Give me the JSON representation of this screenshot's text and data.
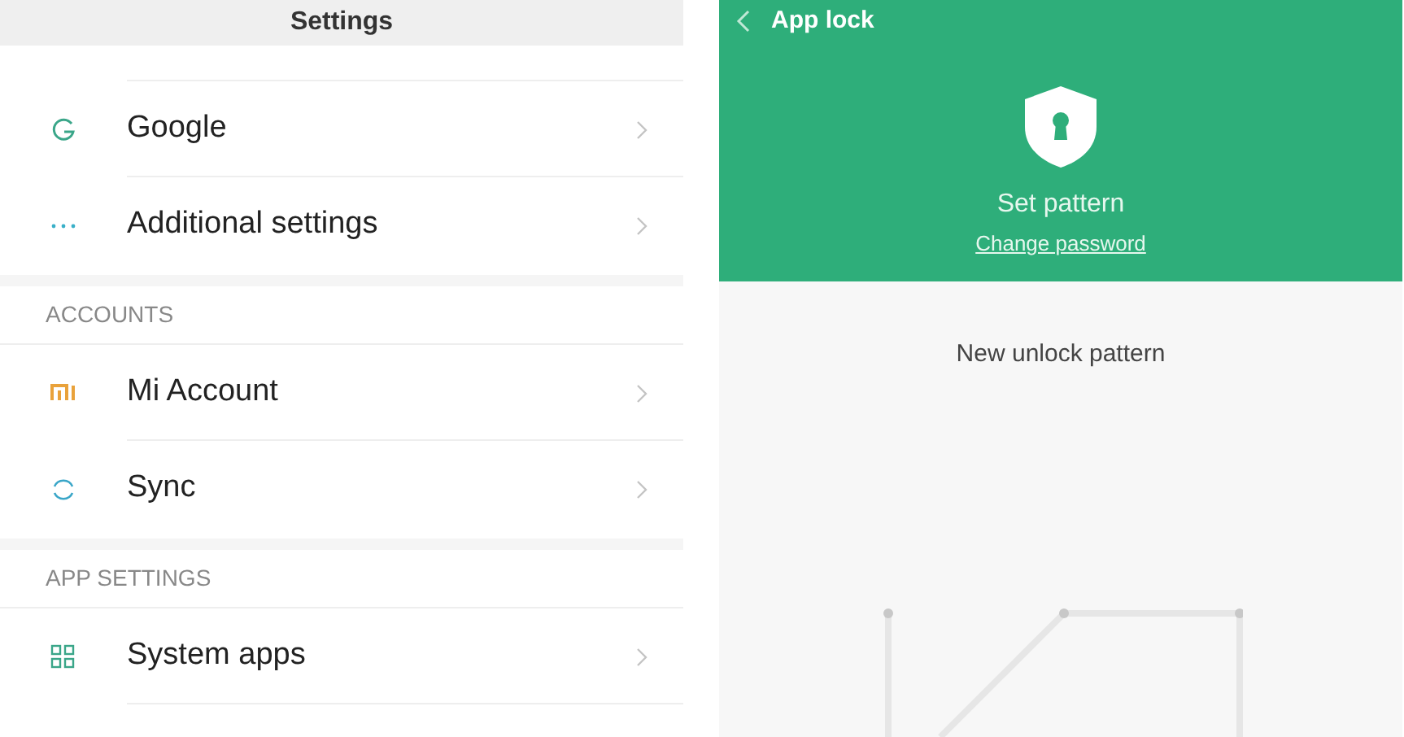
{
  "settings": {
    "title": "Settings",
    "sections": [
      {
        "items": [
          {
            "label": "Google"
          },
          {
            "label": "Additional settings"
          }
        ]
      },
      {
        "header": "ACCOUNTS",
        "items": [
          {
            "label": "Mi Account"
          },
          {
            "label": "Sync"
          }
        ]
      },
      {
        "header": "APP SETTINGS",
        "items": [
          {
            "label": "System apps"
          }
        ]
      }
    ]
  },
  "app_lock": {
    "title": "App lock",
    "heading": "Set pattern",
    "link": "Change password",
    "prompt": "New unlock pattern"
  }
}
